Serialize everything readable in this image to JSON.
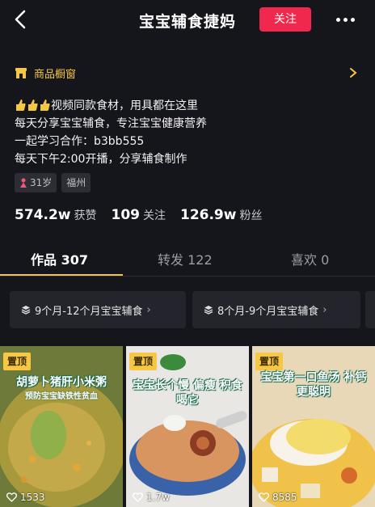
{
  "header": {
    "title": "宝宝辅食捷妈",
    "follow_label": "关注"
  },
  "shop": {
    "label": "商品橱窗"
  },
  "bio": {
    "lines": [
      "视频同款食材，用具都在这里",
      "每天分享宝宝辅食，专注宝宝健康营养",
      "一起学习合作：b3bb555",
      "每天下午2:00开播，分享辅食制作"
    ]
  },
  "tags": {
    "age": "31岁",
    "city": "福州"
  },
  "stats": {
    "likes_num": "574.2w",
    "likes_label": "获赞",
    "following_num": "109",
    "following_label": "关注",
    "fans_num": "126.9w",
    "fans_label": "粉丝"
  },
  "tabs": [
    "作品 307",
    "转发 122",
    "喜欢 0"
  ],
  "collections": [
    "9个月-12个月宝宝辅食",
    "8个月-9个月宝宝辅食"
  ],
  "videos": [
    {
      "pin": "置顶",
      "caption": "胡萝卜猪肝小米粥",
      "subcaption": "预防宝宝缺铁性贫血",
      "likes": "1533"
    },
    {
      "pin": "置顶",
      "caption": "宝宝长个慢 偏瘦 积食 喝它",
      "subcaption": "",
      "likes": "1.7w"
    },
    {
      "pin": "置顶",
      "caption": "宝宝第一口鱼汤 补钙更聪明",
      "subcaption": "",
      "likes": "8585"
    }
  ],
  "colors": {
    "accent_red": "#f0284d",
    "accent_yellow": "#f6c744",
    "background": "#15161c"
  }
}
